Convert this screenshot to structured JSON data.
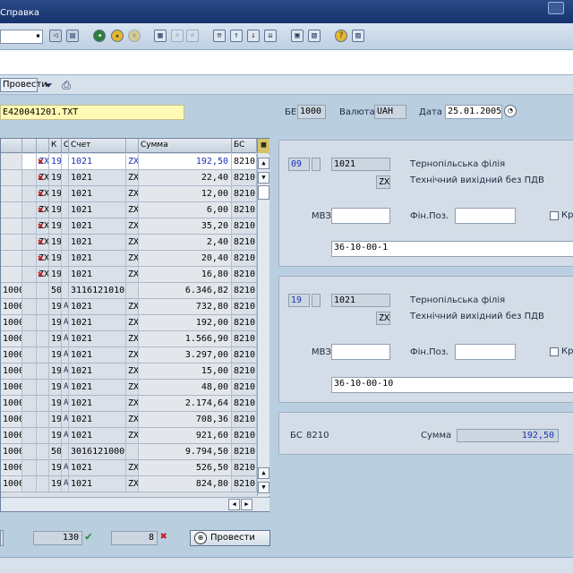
{
  "menu": {
    "title_fragment": "Справка"
  },
  "header": {
    "post_button_label": "Провести",
    "filename": "E420041201.TXT",
    "company_code_label": "БЕ",
    "company_code_value": "1000",
    "currency_label": "Валюта",
    "currency_value": "UAH",
    "date_label": "Дата",
    "date_value": "25.01.2005"
  },
  "table": {
    "columns": [
      "",
      "",
      "",
      "К",
      "С",
      "Счет",
      "",
      "Сумма",
      "БС"
    ],
    "rows": [
      {
        "c0": "",
        "c1": "",
        "c2": "ZX",
        "mark": "x",
        "k": "19",
        "s": "",
        "acct": "1021",
        "zx": "ZX",
        "amount": "192,50",
        "bs": "8210",
        "sel": true
      },
      {
        "c0": "",
        "c1": "",
        "c2": "ZX",
        "mark": "x",
        "k": "19",
        "s": "",
        "acct": "1021",
        "zx": "ZX",
        "amount": "22,40",
        "bs": "8210"
      },
      {
        "c0": "",
        "c1": "",
        "c2": "ZX",
        "mark": "x",
        "k": "19",
        "s": "",
        "acct": "1021",
        "zx": "ZX",
        "amount": "12,00",
        "bs": "8210"
      },
      {
        "c0": "",
        "c1": "",
        "c2": "ZX",
        "mark": "x",
        "k": "19",
        "s": "",
        "acct": "1021",
        "zx": "ZX",
        "amount": "6,00",
        "bs": "8210"
      },
      {
        "c0": "",
        "c1": "",
        "c2": "ZX",
        "mark": "x",
        "k": "19",
        "s": "",
        "acct": "1021",
        "zx": "ZX",
        "amount": "35,20",
        "bs": "8210"
      },
      {
        "c0": "",
        "c1": "",
        "c2": "ZX",
        "mark": "x",
        "k": "19",
        "s": "",
        "acct": "1021",
        "zx": "ZX",
        "amount": "2,40",
        "bs": "8210"
      },
      {
        "c0": "",
        "c1": "",
        "c2": "ZX",
        "mark": "x",
        "k": "19",
        "s": "",
        "acct": "1021",
        "zx": "ZX",
        "amount": "20,40",
        "bs": "8210"
      },
      {
        "c0": "",
        "c1": "",
        "c2": "ZX",
        "mark": "x",
        "k": "19",
        "s": "",
        "acct": "1021",
        "zx": "ZX",
        "amount": "16,80",
        "bs": "8210"
      },
      {
        "c0": "1000",
        "c1": "",
        "c2": "",
        "mark": "",
        "k": "50",
        "s": "",
        "acct": "3116121010",
        "zx": "",
        "amount": "6.346,82",
        "bs": "8210"
      },
      {
        "c0": "1000",
        "c1": "",
        "c2": "",
        "mark": "",
        "k": "19",
        "s": "A",
        "acct": "1021",
        "zx": "ZX",
        "amount": "732,80",
        "bs": "8210"
      },
      {
        "c0": "1000",
        "c1": "",
        "c2": "",
        "mark": "",
        "k": "19",
        "s": "A",
        "acct": "1021",
        "zx": "ZX",
        "amount": "192,00",
        "bs": "8210"
      },
      {
        "c0": "1000",
        "c1": "",
        "c2": "",
        "mark": "",
        "k": "19",
        "s": "A",
        "acct": "1021",
        "zx": "ZX",
        "amount": "1.566,90",
        "bs": "8210"
      },
      {
        "c0": "1000",
        "c1": "",
        "c2": "",
        "mark": "",
        "k": "19",
        "s": "A",
        "acct": "1021",
        "zx": "ZX",
        "amount": "3.297,00",
        "bs": "8210"
      },
      {
        "c0": "1000",
        "c1": "",
        "c2": "",
        "mark": "",
        "k": "19",
        "s": "A",
        "acct": "1021",
        "zx": "ZX",
        "amount": "15,00",
        "bs": "8210"
      },
      {
        "c0": "1000",
        "c1": "",
        "c2": "",
        "mark": "",
        "k": "19",
        "s": "A",
        "acct": "1021",
        "zx": "ZX",
        "amount": "48,00",
        "bs": "8210"
      },
      {
        "c0": "1000",
        "c1": "",
        "c2": "",
        "mark": "",
        "k": "19",
        "s": "A",
        "acct": "1021",
        "zx": "ZX",
        "amount": "2.174,64",
        "bs": "8210"
      },
      {
        "c0": "1000",
        "c1": "",
        "c2": "",
        "mark": "",
        "k": "19",
        "s": "A",
        "acct": "1021",
        "zx": "ZX",
        "amount": "708,36",
        "bs": "8210"
      },
      {
        "c0": "1000",
        "c1": "",
        "c2": "",
        "mark": "",
        "k": "19",
        "s": "A",
        "acct": "1021",
        "zx": "ZX",
        "amount": "921,60",
        "bs": "8210"
      },
      {
        "c0": "1000",
        "c1": "",
        "c2": "",
        "mark": "",
        "k": "50",
        "s": "",
        "acct": "3016121000",
        "zx": "",
        "amount": "9.794,50",
        "bs": "8210"
      },
      {
        "c0": "1000",
        "c1": "",
        "c2": "",
        "mark": "",
        "k": "19",
        "s": "A",
        "acct": "1021",
        "zx": "ZX",
        "amount": "526,50",
        "bs": "8210"
      },
      {
        "c0": "1000",
        "c1": "",
        "c2": "",
        "mark": "",
        "k": "19",
        "s": "A",
        "acct": "1021",
        "zx": "ZX",
        "amount": "824,80",
        "bs": "8210"
      }
    ]
  },
  "panel1": {
    "k": "09",
    "acct": "1021",
    "tax": "ZX",
    "branch": "Тернопільська філія",
    "tax_desc": "Технічний вихідний без ПДВ",
    "mvz_label": "МВЗ",
    "finpos_label": "Фін.Поз.",
    "kr_label": "Кр",
    "text": "36-10-00-1"
  },
  "panel2": {
    "k": "19",
    "acct": "1021",
    "tax": "ZX",
    "branch": "Тернопільська філія",
    "tax_desc": "Технічний вихідний без ПДВ",
    "mvz_label": "МВЗ",
    "finpos_label": "Фін.Поз.",
    "kr_label": "Кр",
    "text": "36-10-00-10"
  },
  "panel3": {
    "bs_label": "БС",
    "bs_value": "8210",
    "sum_label": "Сумма",
    "sum_value": "192,50"
  },
  "footer": {
    "ok_count": "130",
    "err_count": "8",
    "post_label": "Провести"
  },
  "colors": {
    "accent": "#1a2fb8",
    "error": "#c21d1d",
    "ok": "#2e8b3a"
  }
}
